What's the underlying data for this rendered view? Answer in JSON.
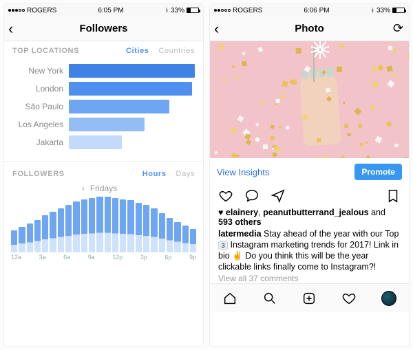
{
  "left": {
    "status": {
      "carrier": "ROGERS",
      "time": "6:05 PM",
      "battery": "33%"
    },
    "nav_title": "Followers",
    "top_locations": {
      "label": "TOP LOCATIONS",
      "tabs": {
        "active": "Cities",
        "inactive": "Countries"
      }
    },
    "followers_section": {
      "label": "FOLLOWERS",
      "tabs": {
        "active": "Hours",
        "inactive": "Days"
      },
      "day_label": "Fridays"
    }
  },
  "right": {
    "status": {
      "carrier": "ROGERS",
      "time": "6:06 PM",
      "battery": "33%"
    },
    "nav_title": "Photo",
    "view_insights": "View Insights",
    "promote": "Promote",
    "likes_prefix_user1": "elainery",
    "likes_user2": "peanutbutterrand_jealous",
    "likes_and": " and ",
    "likes_others": "593 others",
    "caption_user": "latermedia",
    "caption_part1": " Stay ahead of the year with our Top ",
    "caption_emoji1": "3",
    "caption_part2": " Instagram marketing trends for 2017! Link in bio ",
    "caption_emoji2": "✌",
    "caption_part3": "  Do you think this will be the year clickable links finally come to Instagram?!",
    "view_comments": "View all 37 comments"
  },
  "chart_data": [
    {
      "type": "bar",
      "orientation": "horizontal",
      "title": "Top Locations — Cities",
      "categories": [
        "New York",
        "London",
        "São Paulo",
        "Los Angeles",
        "Jakarta"
      ],
      "values": [
        100,
        98,
        80,
        60,
        42
      ],
      "colors": [
        "#3e82e6",
        "#4f8ff0",
        "#6ea6f3",
        "#94bdf6",
        "#c2dafb"
      ],
      "xlabel": "",
      "ylabel": "",
      "xlim": [
        0,
        100
      ]
    },
    {
      "type": "bar",
      "title": "Followers — Hours (Fridays)",
      "categories": [
        "12a",
        "1a",
        "2a",
        "3a",
        "4a",
        "5a",
        "6a",
        "7a",
        "8a",
        "9a",
        "10a",
        "11a",
        "12p",
        "1p",
        "2p",
        "3p",
        "4p",
        "5p",
        "6p",
        "7p",
        "8p",
        "9p",
        "10p",
        "11p"
      ],
      "values": [
        38,
        44,
        50,
        56,
        64,
        70,
        76,
        82,
        88,
        92,
        94,
        96,
        96,
        94,
        92,
        90,
        86,
        82,
        76,
        68,
        60,
        52,
        46,
        40
      ],
      "colors_note": "stacked appearance: bottom ~35% pale #cfe2fb, top remainder #6ea6f3",
      "xlabel": "Hour",
      "ylabel": "",
      "ylim": [
        0,
        100
      ],
      "tick_labels": [
        "12a",
        "3a",
        "6a",
        "9a",
        "12p",
        "3p",
        "6p",
        "9p"
      ]
    }
  ]
}
